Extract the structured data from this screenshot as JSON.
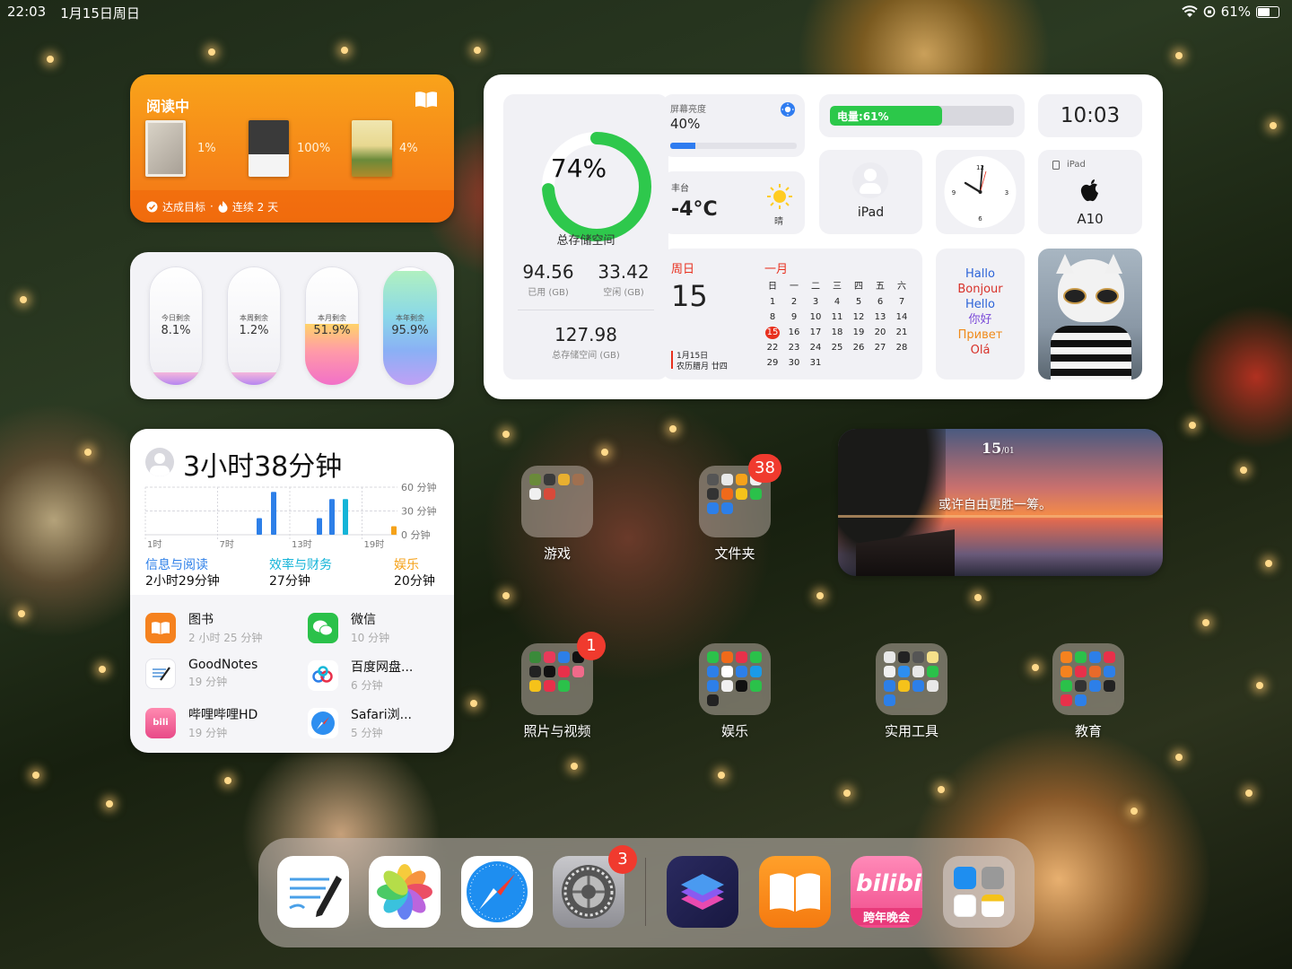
{
  "status_bar": {
    "time": "22:03",
    "date": "1月15日周日",
    "battery": "61%",
    "battery_level": 0.61
  },
  "reading": {
    "title": "阅读中",
    "books": [
      {
        "progress": "1%"
      },
      {
        "progress": "100%"
      },
      {
        "progress": "4%"
      }
    ],
    "goal": "达成目标",
    "dot": "·",
    "streak": "连续 2 天"
  },
  "remaining": {
    "items": [
      {
        "label": "今日剩余",
        "value": "8.1%",
        "level": 0.081
      },
      {
        "label": "本周剩余",
        "value": "1.2%",
        "level": 0.012
      },
      {
        "label": "本月剩余",
        "value": "51.9%",
        "level": 0.519
      },
      {
        "label": "本年剩余",
        "value": "95.9%",
        "level": 0.959
      }
    ]
  },
  "storage": {
    "percent": "74%",
    "level": 0.74,
    "label": "总存储空间",
    "used": "94.56",
    "used_label": "已用 (GB)",
    "free": "33.42",
    "free_label": "空闲 (GB)",
    "total": "127.98",
    "total_label": "总存储空间 (GB)"
  },
  "brightness": {
    "label": "屏幕亮度",
    "value": "40%",
    "level": 0.4
  },
  "battery_widget": {
    "label": "电量:61%",
    "level": 0.61
  },
  "clock_digital": {
    "time": "10:03"
  },
  "weather": {
    "city": "丰台",
    "temp": "-4°C",
    "condition": "晴"
  },
  "device": {
    "name": "iPad"
  },
  "analog_clock": {
    "n12": "12",
    "n3": "3",
    "n6": "6",
    "n9": "9"
  },
  "device_model": {
    "type": "iPad",
    "model": "A10"
  },
  "calendar": {
    "weekday": "周日",
    "day": "15",
    "month": "一月",
    "note_date": "1月15日",
    "note_lunar": "农历腊月 廿四",
    "headers": [
      "日",
      "一",
      "二",
      "三",
      "四",
      "五",
      "六"
    ],
    "days": [
      "1",
      "2",
      "3",
      "4",
      "5",
      "6",
      "7",
      "8",
      "9",
      "10",
      "11",
      "12",
      "13",
      "14",
      "15",
      "16",
      "17",
      "18",
      "19",
      "20",
      "21",
      "22",
      "23",
      "24",
      "25",
      "26",
      "27",
      "28",
      "29",
      "30",
      "31"
    ],
    "today": "15"
  },
  "greetings": {
    "lines": [
      {
        "text": "Hallo",
        "color": "#2d64d8"
      },
      {
        "text": "Bonjour",
        "color": "#d8322a"
      },
      {
        "text": "Hello",
        "color": "#2d64d8"
      },
      {
        "text": "你好",
        "color": "#7a4ad8"
      },
      {
        "text": "Привет",
        "color": "#f08a1a"
      },
      {
        "text": "Olá",
        "color": "#d8322a"
      }
    ]
  },
  "screen_time": {
    "total": "3小时38分钟",
    "y_labels": [
      "60 分钟",
      "30 分钟",
      "0 分钟"
    ],
    "x_labels": [
      "1时",
      "7时",
      "13时",
      "19时"
    ],
    "categories": [
      {
        "name": "信息与阅读",
        "time": "2小时29分钟",
        "color": "#2d7fe8"
      },
      {
        "name": "效率与财务",
        "time": "27分钟",
        "color": "#14b4d8"
      },
      {
        "name": "娱乐",
        "time": "20分钟",
        "color": "#f5a21a"
      }
    ],
    "apps": [
      {
        "name": "图书",
        "time": "2 小时 25 分钟",
        "icon": "books-icon",
        "color": "#f5821f"
      },
      {
        "name": "微信",
        "time": "10 分钟",
        "icon": "wechat-icon",
        "color": "#2bc14a"
      },
      {
        "name": "GoodNotes",
        "time": "19 分钟",
        "icon": "goodnotes-icon",
        "color": "#ffffff"
      },
      {
        "name": "百度网盘...",
        "time": "6 分钟",
        "icon": "baidu-netdisk-icon",
        "color": "#ffffff"
      },
      {
        "name": "哔哩哔哩HD",
        "time": "19 分钟",
        "icon": "bilibili-icon",
        "color": "#f36a9a"
      },
      {
        "name": "Safari浏...",
        "time": "5 分钟",
        "icon": "safari-icon",
        "color": "#ffffff"
      }
    ]
  },
  "photo_widget": {
    "date": "15",
    "date_sub": "/01",
    "quote": "或许自由更胜一筹。"
  },
  "folders": [
    {
      "name": "游戏"
    },
    {
      "name": "文件夹",
      "badge": "38"
    },
    {
      "name": "照片与视频",
      "badge": "1"
    },
    {
      "name": "娱乐"
    },
    {
      "name": "实用工具"
    },
    {
      "name": "教育"
    }
  ],
  "dock": {
    "apps": [
      "GoodNotes",
      "照片",
      "Safari浏览器",
      "设置",
      "Craft",
      "图书",
      "哔哩哔哩",
      "App资源库"
    ],
    "settings_badge": "3",
    "bilibili_caption": "跨年晚会"
  }
}
